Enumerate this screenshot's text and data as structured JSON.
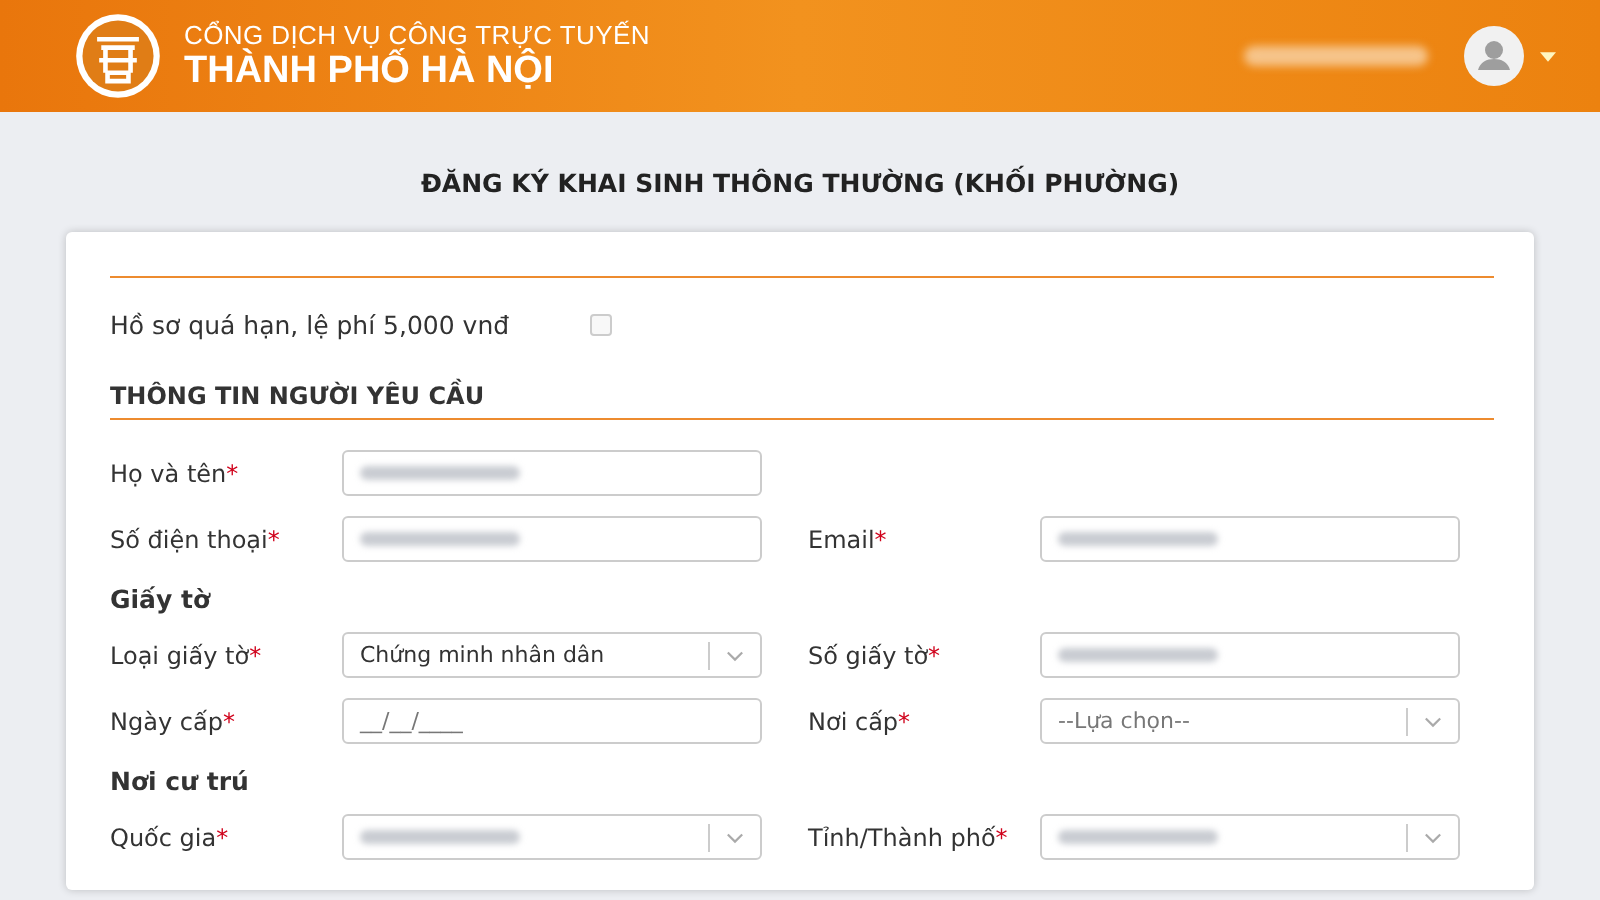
{
  "header": {
    "title_line1": "CỔNG DỊCH VỤ CÔNG TRỰC TUYẾN",
    "title_line2": "THÀNH PHỐ HÀ NỘI",
    "user_name_redacted": true
  },
  "page_title": "ĐĂNG KÝ KHAI SINH THÔNG THƯỜNG (KHỐI PHƯỜNG)",
  "overdue": {
    "label": "Hồ sơ quá hạn, lệ phí 5,000 vnđ",
    "checked": false
  },
  "sections": [
    {
      "title": "THÔNG TIN NGƯỜI YÊU CẦU",
      "kind": "main",
      "rows": [
        [
          {
            "label": "Họ và tên",
            "required_mark": "*",
            "kind": "text",
            "redacted": true
          }
        ],
        [
          {
            "label": "Số điện thoại",
            "required_mark": "*",
            "kind": "text",
            "redacted": true
          },
          {
            "label": "Email",
            "required_mark": "*",
            "kind": "text",
            "redacted": true
          }
        ]
      ]
    },
    {
      "title": "Giấy tờ",
      "kind": "sub",
      "rows": [
        [
          {
            "label": "Loại giấy tờ",
            "required_mark": "*",
            "kind": "select",
            "value": "Chứng minh nhân dân"
          },
          {
            "label": "Số giấy tờ",
            "required_mark": "*",
            "kind": "text",
            "redacted": true
          }
        ],
        [
          {
            "label": "Ngày cấp",
            "required_mark": "*",
            "kind": "text",
            "placeholder": "__/__/____"
          },
          {
            "label": "Nơi cấp",
            "required_mark": "*",
            "kind": "select",
            "placeholder": "--Lựa chọn--"
          }
        ]
      ]
    },
    {
      "title": "Nơi cư trú",
      "kind": "sub",
      "rows": [
        [
          {
            "label": "Quốc gia",
            "required_mark": "*",
            "kind": "select",
            "redacted": true
          },
          {
            "label": "Tỉnh/Thành phố",
            "required_mark": "*",
            "kind": "select",
            "redacted": true
          }
        ]
      ]
    }
  ]
}
